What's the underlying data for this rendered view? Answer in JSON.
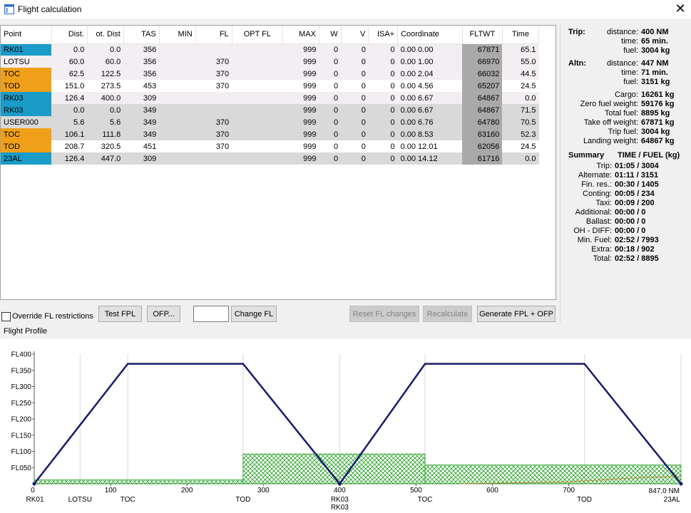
{
  "window": {
    "title": "Flight calculation"
  },
  "table": {
    "columns": [
      "Point",
      "Dist.",
      "ot. Dist",
      "TAS",
      "MIN",
      "FL",
      "OPT FL",
      "MAX",
      "W",
      "V",
      "ISA+",
      "Coordinate",
      "FLTWT",
      "Time"
    ],
    "rows": [
      {
        "point": "RK01",
        "tag": "blue",
        "shade": "rowA",
        "dist": "0.0",
        "tot": "0.0",
        "tas": "356",
        "min": "",
        "fl": "",
        "opt": "",
        "max": "999",
        "w": "0",
        "v": "0",
        "isa": "0",
        "coord": "0.00  0.00",
        "fltwt": "67871",
        "time": "65.1"
      },
      {
        "point": "LOTSU",
        "tag": "",
        "shade": "rowA",
        "dist": "60.0",
        "tot": "60.0",
        "tas": "356",
        "min": "",
        "fl": "370",
        "opt": "",
        "max": "999",
        "w": "0",
        "v": "0",
        "isa": "0",
        "coord": "0.00  1.00",
        "fltwt": "66970",
        "time": "55.0"
      },
      {
        "point": "TOC",
        "tag": "orange",
        "shade": "rowA",
        "dist": "62.5",
        "tot": "122.5",
        "tas": "356",
        "min": "",
        "fl": "370",
        "opt": "",
        "max": "999",
        "w": "0",
        "v": "0",
        "isa": "0",
        "coord": "0.00  2.04",
        "fltwt": "66032",
        "time": "44.5"
      },
      {
        "point": "TOD",
        "tag": "orange",
        "shade": "rowB",
        "dist": "151.0",
        "tot": "273.5",
        "tas": "453",
        "min": "",
        "fl": "370",
        "opt": "",
        "max": "999",
        "w": "0",
        "v": "0",
        "isa": "0",
        "coord": "0.00  4.56",
        "fltwt": "65207",
        "time": "24.5"
      },
      {
        "point": "RK03",
        "tag": "blue",
        "shade": "rowA",
        "dist": "126.4",
        "tot": "400.0",
        "tas": "309",
        "min": "",
        "fl": "",
        "opt": "",
        "max": "999",
        "w": "0",
        "v": "0",
        "isa": "0",
        "coord": "0.00  6.67",
        "fltwt": "64867",
        "time": "0.0"
      },
      {
        "point": "RK03",
        "tag": "blue",
        "shade": "rowC",
        "dist": "0.0",
        "tot": "0.0",
        "tas": "349",
        "min": "",
        "fl": "",
        "opt": "",
        "max": "999",
        "w": "0",
        "v": "0",
        "isa": "0",
        "coord": "0.00  6.67",
        "fltwt": "64867",
        "time": "71.5"
      },
      {
        "point": "USER000",
        "tag": "",
        "shade": "rowC",
        "dist": "5.6",
        "tot": "5.6",
        "tas": "349",
        "min": "",
        "fl": "370",
        "opt": "",
        "max": "999",
        "w": "0",
        "v": "0",
        "isa": "0",
        "coord": "0.00  6.76",
        "fltwt": "64780",
        "time": "70.5"
      },
      {
        "point": "TOC",
        "tag": "orange",
        "shade": "rowC",
        "dist": "106.1",
        "tot": "111.8",
        "tas": "349",
        "min": "",
        "fl": "370",
        "opt": "",
        "max": "999",
        "w": "0",
        "v": "0",
        "isa": "0",
        "coord": "0.00  8.53",
        "fltwt": "63160",
        "time": "52.3"
      },
      {
        "point": "TOD",
        "tag": "orange",
        "shade": "rowB",
        "dist": "208.7",
        "tot": "320.5",
        "tas": "451",
        "min": "",
        "fl": "370",
        "opt": "",
        "max": "999",
        "w": "0",
        "v": "0",
        "isa": "0",
        "coord": "0.00  12.01",
        "fltwt": "62056",
        "time": "24.5"
      },
      {
        "point": "23AL",
        "tag": "blue",
        "shade": "rowC",
        "dist": "126.4",
        "tot": "447.0",
        "tas": "309",
        "min": "",
        "fl": "",
        "opt": "",
        "max": "999",
        "w": "0",
        "v": "0",
        "isa": "0",
        "coord": "0.00  14.12",
        "fltwt": "61716",
        "time": "0.0"
      }
    ]
  },
  "summary": {
    "trip_head": "Trip:",
    "trip": [
      {
        "k": "distance:",
        "v": "400 NM"
      },
      {
        "k": "time:",
        "v": "65 min."
      },
      {
        "k": "fuel:",
        "v": "3004 kg"
      }
    ],
    "altn_head": "Altn:",
    "altn": [
      {
        "k": "distance:",
        "v": "447 NM"
      },
      {
        "k": "time:",
        "v": "71 min."
      },
      {
        "k": "fuel:",
        "v": "3151 kg"
      }
    ],
    "weights": [
      {
        "k": "Cargo:",
        "v": "16261 kg"
      },
      {
        "k": "Zero fuel weight:",
        "v": "59176 kg"
      },
      {
        "k": "Total fuel:",
        "v": "8895 kg"
      },
      {
        "k": "Take off weight:",
        "v": "67871 kg"
      },
      {
        "k": "Trip fuel:",
        "v": "3004 kg"
      },
      {
        "k": "Landing weight:",
        "v": "64867 kg"
      }
    ],
    "summary_head": "Summary",
    "summary_cols": "TIME / FUEL (kg)",
    "items": [
      {
        "k": "Trip:",
        "v": "01:05 / 3004"
      },
      {
        "k": "Alternate:",
        "v": "01:11 / 3151"
      },
      {
        "k": "Fin. res.:",
        "v": "00:30 / 1405"
      },
      {
        "k": "Conting:",
        "v": "00:05 / 234"
      },
      {
        "k": "Taxi:",
        "v": "00:09 / 200"
      },
      {
        "k": "Additional:",
        "v": "00:00 / 0"
      },
      {
        "k": "Ballast:",
        "v": "00:00 / 0"
      },
      {
        "k": "OH - DIFF:",
        "v": "00:00 / 0"
      },
      {
        "k": "Min. Fuel:",
        "v": "02:52 / 7993"
      },
      {
        "k": "Extra:",
        "v": "00:18 / 902"
      },
      {
        "k": "Total:",
        "v": "02:52 / 8895"
      }
    ]
  },
  "controls": {
    "override_label": "Override FL restrictions",
    "override_checked": false,
    "test_fpl": "Test FPL",
    "ofp": "OFP...",
    "fl_input_value": "",
    "change_fl": "Change FL",
    "reset_fl": "Reset FL changes",
    "recalculate": "Recalculate",
    "generate": "Generate FPL + OFP"
  },
  "profile": {
    "label": "Flight Profile"
  },
  "chart_data": {
    "type": "line",
    "title": "",
    "xlim": [
      0,
      847
    ],
    "ylim": [
      0,
      400
    ],
    "y_ticks": [
      {
        "v": 50,
        "label": "FL050"
      },
      {
        "v": 100,
        "label": "FL100"
      },
      {
        "v": 150,
        "label": "FL150"
      },
      {
        "v": 200,
        "label": "FL200"
      },
      {
        "v": 250,
        "label": "FL250"
      },
      {
        "v": 300,
        "label": "FL300"
      },
      {
        "v": 350,
        "label": "FL350"
      },
      {
        "v": 400,
        "label": "FL400"
      }
    ],
    "x_ticks": [
      {
        "v": 0,
        "label": "0"
      },
      {
        "v": 100,
        "label": "100"
      },
      {
        "v": 200,
        "label": "200"
      },
      {
        "v": 300,
        "label": "300"
      },
      {
        "v": 400,
        "label": "400"
      },
      {
        "v": 500,
        "label": "500"
      },
      {
        "v": 600,
        "label": "600"
      },
      {
        "v": 700,
        "label": "700"
      }
    ],
    "x_end_label": "847.0 NM",
    "waypoints": [
      {
        "x": 0,
        "label": "RK01"
      },
      {
        "x": 60,
        "label": "LOTSU"
      },
      {
        "x": 122.5,
        "label": "TOC"
      },
      {
        "x": 273.5,
        "label": "TOD"
      },
      {
        "x": 400,
        "label": "RK03",
        "label2": "RK03"
      },
      {
        "x": 511.8,
        "label": "TOC"
      },
      {
        "x": 720.5,
        "label": "TOD"
      },
      {
        "x": 847,
        "label": "23AL"
      }
    ],
    "profile_series": {
      "name": "",
      "color": "#1a1a6e",
      "points": [
        [
          0,
          0
        ],
        [
          122.5,
          370
        ],
        [
          273.5,
          370
        ],
        [
          400,
          0
        ],
        [
          511.8,
          370
        ],
        [
          720.5,
          370
        ],
        [
          847,
          0
        ]
      ]
    },
    "terrain_series": {
      "color": "#1e9e1e",
      "steps": [
        [
          0,
          273.5,
          12
        ],
        [
          273.5,
          511.8,
          92
        ],
        [
          511.8,
          847,
          58
        ]
      ]
    },
    "minor_line": {
      "color": "#b08a30",
      "points": [
        [
          560,
          0
        ],
        [
          700,
          6
        ],
        [
          800,
          20
        ],
        [
          847,
          22
        ]
      ]
    }
  }
}
